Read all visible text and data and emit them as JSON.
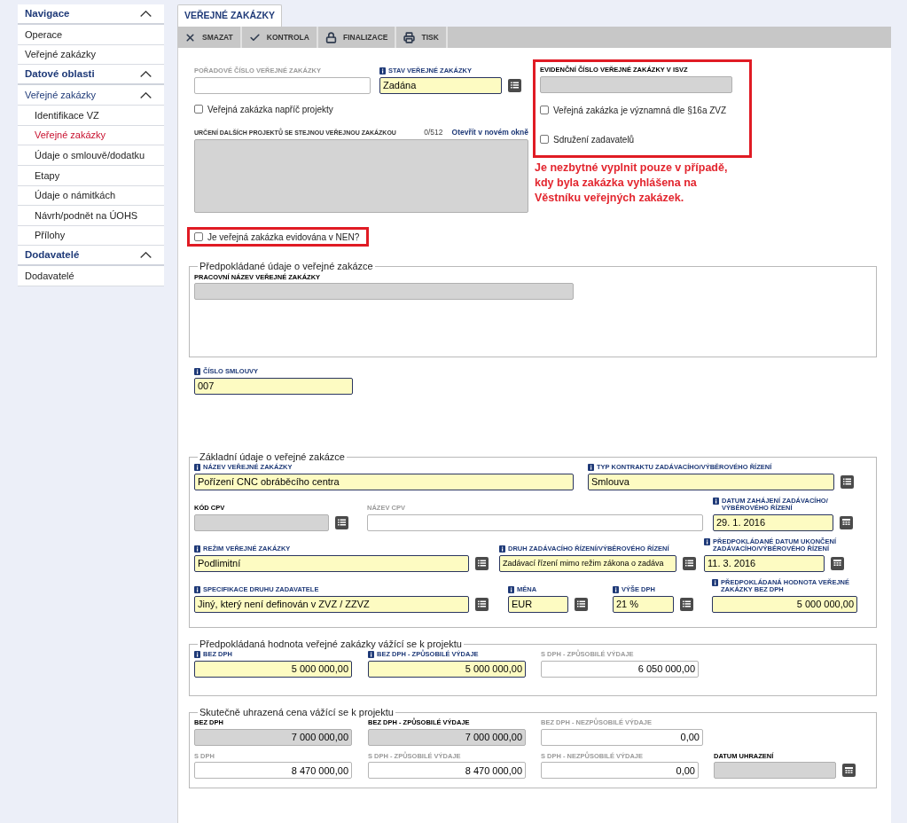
{
  "sidebar": [
    {
      "title": "Navigace",
      "expanded": true,
      "items": [
        {
          "label": "Operace",
          "selected": false
        },
        {
          "label": "Veřejné zakázky",
          "selected": false
        }
      ]
    },
    {
      "title": "Datové oblasti",
      "expanded": true,
      "items": [
        {
          "label": "Veřejné zakázky",
          "selected": false,
          "expanded": true,
          "children": [
            {
              "label": "Identifikace VZ",
              "selected": false
            },
            {
              "label": "Veřejné zakázky",
              "selected": true
            },
            {
              "label": "Údaje o smlouvě/dodatku",
              "selected": false
            },
            {
              "label": "Etapy",
              "selected": false
            },
            {
              "label": "Údaje o námitkách",
              "selected": false
            },
            {
              "label": "Návrh/podnět na ÚOHS",
              "selected": false
            },
            {
              "label": "Přílohy",
              "selected": false
            }
          ]
        }
      ]
    },
    {
      "title": "Dodavatelé",
      "expanded": true,
      "items": [
        {
          "label": "Dodavatelé",
          "selected": false
        }
      ]
    }
  ],
  "tabs": [
    {
      "label": "VEŘEJNÉ ZAKÁZKY",
      "selected": true
    }
  ],
  "toolbar": [
    {
      "label": "SMAZAT",
      "kind": "delete"
    },
    {
      "label": "KONTROLA",
      "kind": "check"
    },
    {
      "label": "FINALIZACE",
      "kind": "lock"
    },
    {
      "label": "TISK",
      "kind": "print"
    }
  ],
  "top": {
    "order_number": {
      "label": "POŘADOVÉ ČÍSLO VEŘEJNÉ ZAKÁZKY",
      "kind": "optional"
    },
    "status": {
      "label": "STAV VEŘEJNÉ ZAKÁZKY",
      "kind": "required",
      "value": "Zadána",
      "list_button": true
    },
    "across_projects": {
      "label": "Veřejná zakázka napříč projekty",
      "checked": false
    },
    "other_projects": {
      "label": "URČENÍ DALŠÍCH PROJEKTŮ SE STEJNOU VEŘEJNOU ZAKÁZKOU",
      "counter": "0/512",
      "link": "Otevřít v novém okně"
    },
    "nen": {
      "label": "Je veřejná zakázka evidována v NEN?",
      "checked": false
    },
    "isvz": {
      "label": "EVIDENČNÍ ČÍSLO VEŘEJNÉ ZAKÁZKY V ISVZ",
      "kind": "readonly"
    },
    "isvz_checkboxes": [
      {
        "label": "Veřejná zakázka je významná dle §16a ZVZ",
        "checked": false
      },
      {
        "label": "Sdružení zadavatelů",
        "checked": false
      }
    ],
    "note": [
      "Je nezbytné vyplnit pouze v případě,",
      "kdy byla zakázka vyhlášena na",
      "Věstníku veřejných zakázek."
    ]
  },
  "planned": {
    "legend": "Předpokládané údaje o veřejné zakázce",
    "fields": [
      {
        "label": "PRACOVNÍ NÁZEV VEŘEJNÉ ZAKÁZKY",
        "kind": "readonly"
      }
    ]
  },
  "contract_number": {
    "label": "ČÍSLO SMLOUVY",
    "kind": "required",
    "value": "007"
  },
  "basic": {
    "legend": "Základní údaje o veřejné zakázce",
    "fields": [
      {
        "label": "NÁZEV VEŘEJNÉ ZAKÁZKY",
        "kind": "required",
        "value": "Pořízení CNC obráběcího centra"
      },
      {
        "label": "TYP KONTRAKTU ZADÁVACÍHO/VÝBĚROVÉHO ŘÍZENÍ",
        "kind": "required",
        "value": "Smlouva",
        "list_button": true
      },
      {
        "label": "KÓD CPV",
        "kind": "readonly",
        "list_button": true
      },
      {
        "label": "NÁZEV CPV",
        "kind": "optional"
      },
      {
        "label": "DATUM ZAHÁJENÍ ZADÁVACÍHO/ VÝBĚROVÉHO ŘÍZENÍ",
        "kind": "required",
        "value": "29. 1. 2016",
        "calendar_button": true
      },
      {
        "label": "REŽIM VEŘEJNÉ ZAKÁZKY",
        "kind": "required",
        "value": "Podlimitní",
        "list_button": true
      },
      {
        "label": "DRUH ZADÁVACÍHO ŘÍZENÍ/VÝBĚROVÉHO ŘÍZENÍ",
        "kind": "required",
        "value": "Zadávací řízení mimo režim zákona o zadáva",
        "list_button": true
      },
      {
        "label": "PŘEDPOKLÁDANÉ DATUM UKONČENÍ ZADÁVACÍHO/VÝBĚROVÉHO ŘÍZENÍ",
        "kind": "required",
        "value": "11. 3. 2016",
        "calendar_button": true
      },
      {
        "label": "SPECIFIKACE DRUHU ZADAVATELE",
        "kind": "required",
        "value": "Jiný, který není definován v ZVZ / ZZVZ",
        "list_button": true
      },
      {
        "label": "MĚNA",
        "kind": "required",
        "value": "EUR",
        "list_button": true
      },
      {
        "label": "VÝŠE DPH",
        "kind": "required",
        "value": "21 %",
        "list_button": true
      },
      {
        "label": "PŘEDPOKLÁDANÁ HODNOTA VEŘEJNÉ ZAKÁZKY BEZ DPH",
        "kind": "required",
        "value": "5 000 000,00",
        "numeric": true
      }
    ]
  },
  "expected_value": {
    "legend": "Předpokládaná hodnota veřejné zakázky vážící se k projektu",
    "fields": [
      {
        "label": "BEZ DPH",
        "kind": "required",
        "value": "5 000 000,00",
        "numeric": true
      },
      {
        "label": "BEZ DPH - ZPŮSOBILÉ VÝDAJE",
        "kind": "required",
        "value": "5 000 000,00",
        "numeric": true
      },
      {
        "label": "S DPH - ZPŮSOBILÉ VÝDAJE",
        "kind": "optional",
        "value": "6 050 000,00",
        "numeric": true
      }
    ]
  },
  "actual_price": {
    "legend": "Skutečně uhrazená cena vážící se k projektu",
    "fields": [
      {
        "label": "BEZ DPH",
        "kind": "readonly",
        "value": "7 000 000,00",
        "numeric": true
      },
      {
        "label": "BEZ DPH - ZPŮSOBILÉ VÝDAJE",
        "kind": "readonly",
        "value": "7 000 000,00",
        "numeric": true
      },
      {
        "label": "BEZ DPH - NEZPŮSOBILÉ VÝDAJE",
        "kind": "optional",
        "value": "0,00",
        "numeric": true
      },
      {
        "label": "S DPH",
        "kind": "optional",
        "value": "8 470 000,00",
        "numeric": true
      },
      {
        "label": "S DPH - ZPŮSOBILÉ VÝDAJE",
        "kind": "optional",
        "value": "8 470 000,00",
        "numeric": true
      },
      {
        "label": "S DPH - NEZPŮSOBILÉ VÝDAJE",
        "kind": "optional",
        "value": "0,00",
        "numeric": true
      },
      {
        "label": "DATUM UHRAZENÍ",
        "kind": "readonly",
        "calendar_button": true
      }
    ]
  }
}
